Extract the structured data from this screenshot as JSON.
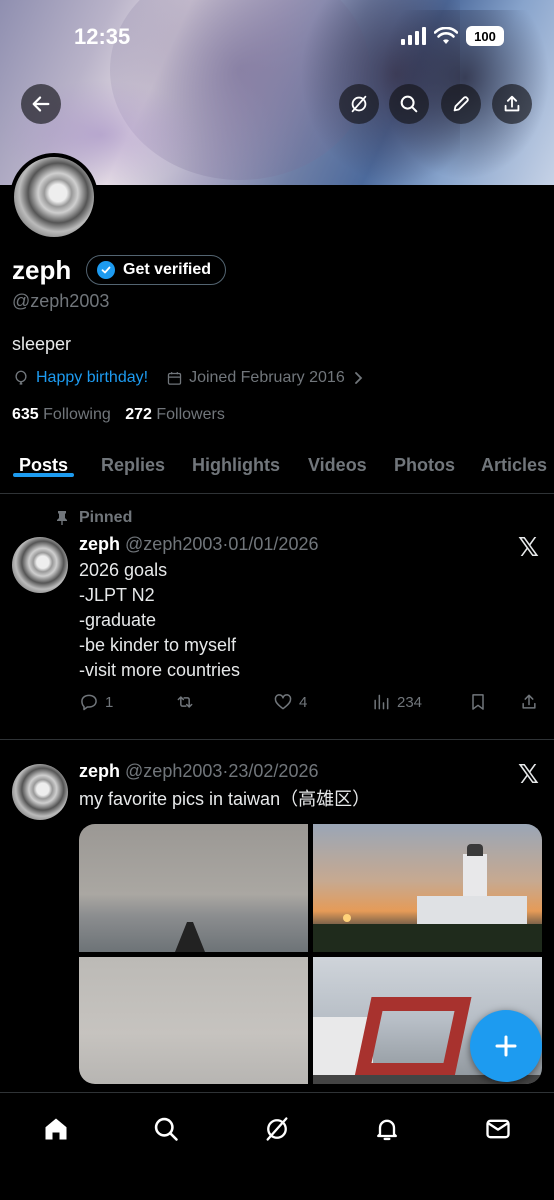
{
  "status_bar": {
    "time": "12:35",
    "battery": "100"
  },
  "profile": {
    "name": "zeph",
    "verify_label": "Get verified",
    "handle": "@zeph2003",
    "bio": "sleeper",
    "birthday": "Happy birthday!",
    "joined": "Joined February 2016",
    "following_count": "635",
    "following_label": "Following",
    "followers_count": "272",
    "followers_label": "Followers"
  },
  "tabs": [
    {
      "label": "Posts"
    },
    {
      "label": "Replies"
    },
    {
      "label": "Highlights"
    },
    {
      "label": "Videos"
    },
    {
      "label": "Photos"
    },
    {
      "label": "Articles"
    }
  ],
  "posts": [
    {
      "pinned_label": "Pinned",
      "name": "zeph",
      "handle": "@zeph2003",
      "date": "01/01/2026",
      "text": "2026 goals\n-JLPT N2\n-graduate\n-be kinder to myself\n-visit more countries",
      "replies": "1",
      "reposts": "",
      "likes": "4",
      "views": "234"
    },
    {
      "name": "zeph",
      "handle": "@zeph2003",
      "date": "23/02/2026",
      "text": "my favorite pics in taiwan（高雄区）"
    }
  ],
  "colors": {
    "accent": "#1d9bf0",
    "muted": "#71767b",
    "background": "#000000"
  }
}
